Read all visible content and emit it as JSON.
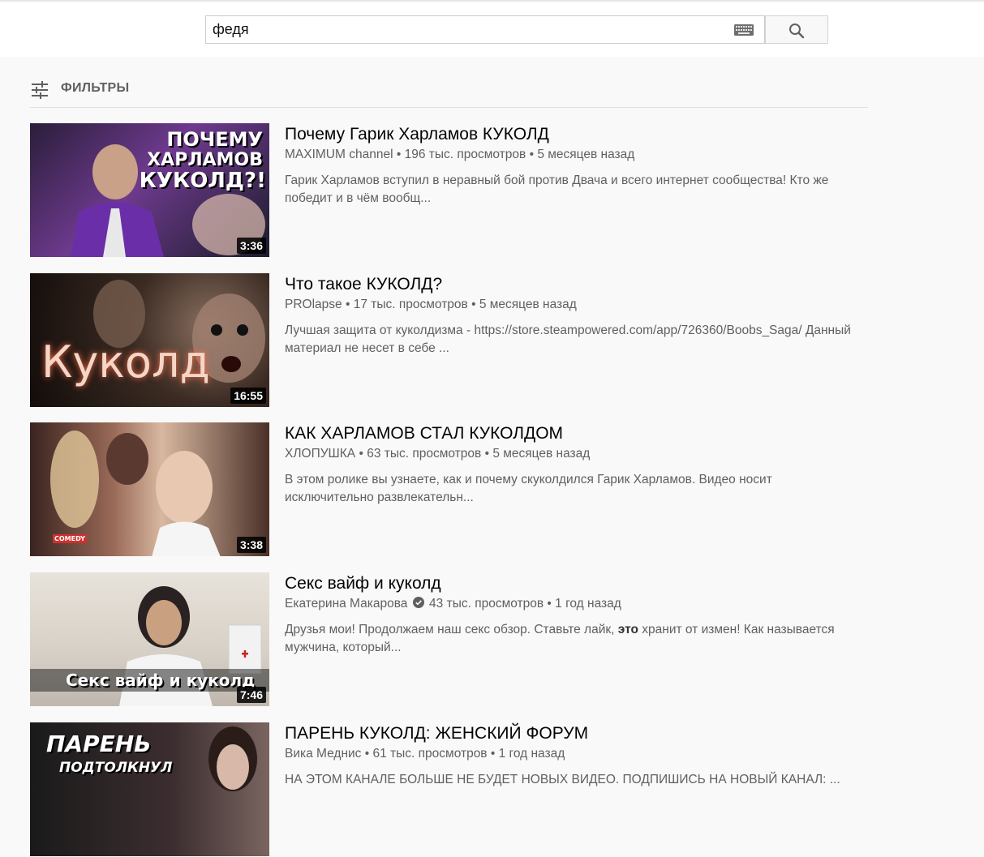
{
  "search": {
    "value": "федя"
  },
  "filters": {
    "label": "ФИЛЬТРЫ"
  },
  "results": [
    {
      "title": "Почему Гарик Харламов КУКОЛД",
      "channel": "MAXIMUM channel",
      "views": "196 тыс. просмотров",
      "age": "5 месяцев назад",
      "description": "Гарик Харламов вступил в неравный бой против Двача и всего интернет сообщества! Кто же победит и в чём вообщ...",
      "duration": "3:36",
      "thumb_text": [
        "ПОЧЕМУ",
        "ХАРЛАМОВ",
        "КУКОЛД?!"
      ]
    },
    {
      "title": "Что такое КУКОЛД?",
      "channel": "PROlapse",
      "views": "17 тыс. просмотров",
      "age": "5 месяцев назад",
      "description": "Лучшая защита от куколдизма - https://store.steampowered.com/app/726360/Boobs_Saga/ Данный материал не несет в себе ...",
      "duration": "16:55",
      "thumb_text": [
        "Куколд"
      ]
    },
    {
      "title": "КАК ХАРЛАМОВ СТАЛ КУКОЛДОМ",
      "channel": "ХЛОПУШКА",
      "views": "63 тыс. просмотров",
      "age": "5 месяцев назад",
      "description": "В этом ролике вы узнаете, как и почему скуколдился Гарик Харламов. Видео носит исключительно развлекательн...",
      "duration": "3:38",
      "thumb_text": [
        "COMEDY"
      ]
    },
    {
      "title": "Секс вайф и куколд",
      "channel": "Екатерина Макарова",
      "views": "43 тыс. просмотров",
      "age": "1 год назад",
      "description_pre": "Друзья мои! Продолжаем наш секс обзор. Ставьте лайк, ",
      "description_bold": "это",
      "description_post": " хранит от измен! Как называется мужчина, который...",
      "duration": "7:46",
      "thumb_text": [
        "Секс вайф и куколд"
      ]
    },
    {
      "title": "ПАРЕНЬ КУКОЛД: ЖЕНСКИЙ ФОРУМ",
      "channel": "Вика Меднис",
      "views": "61 тыс. просмотров",
      "age": "1 год назад",
      "description": "НА ЭТОМ КАНАЛЕ БОЛЬШЕ НЕ БУДЕТ НОВЫХ ВИДЕО. ПОДПИШИСЬ НА НОВЫЙ КАНАЛ: ...",
      "thumb_text": [
        "ПАРЕНЬ",
        "ПОДТОЛКНУЛ"
      ]
    }
  ],
  "separator": "•",
  "icons": {
    "keyboard": "keyboard-icon",
    "search": "search-icon",
    "filters": "tune-icon",
    "verified": "verified-icon"
  }
}
